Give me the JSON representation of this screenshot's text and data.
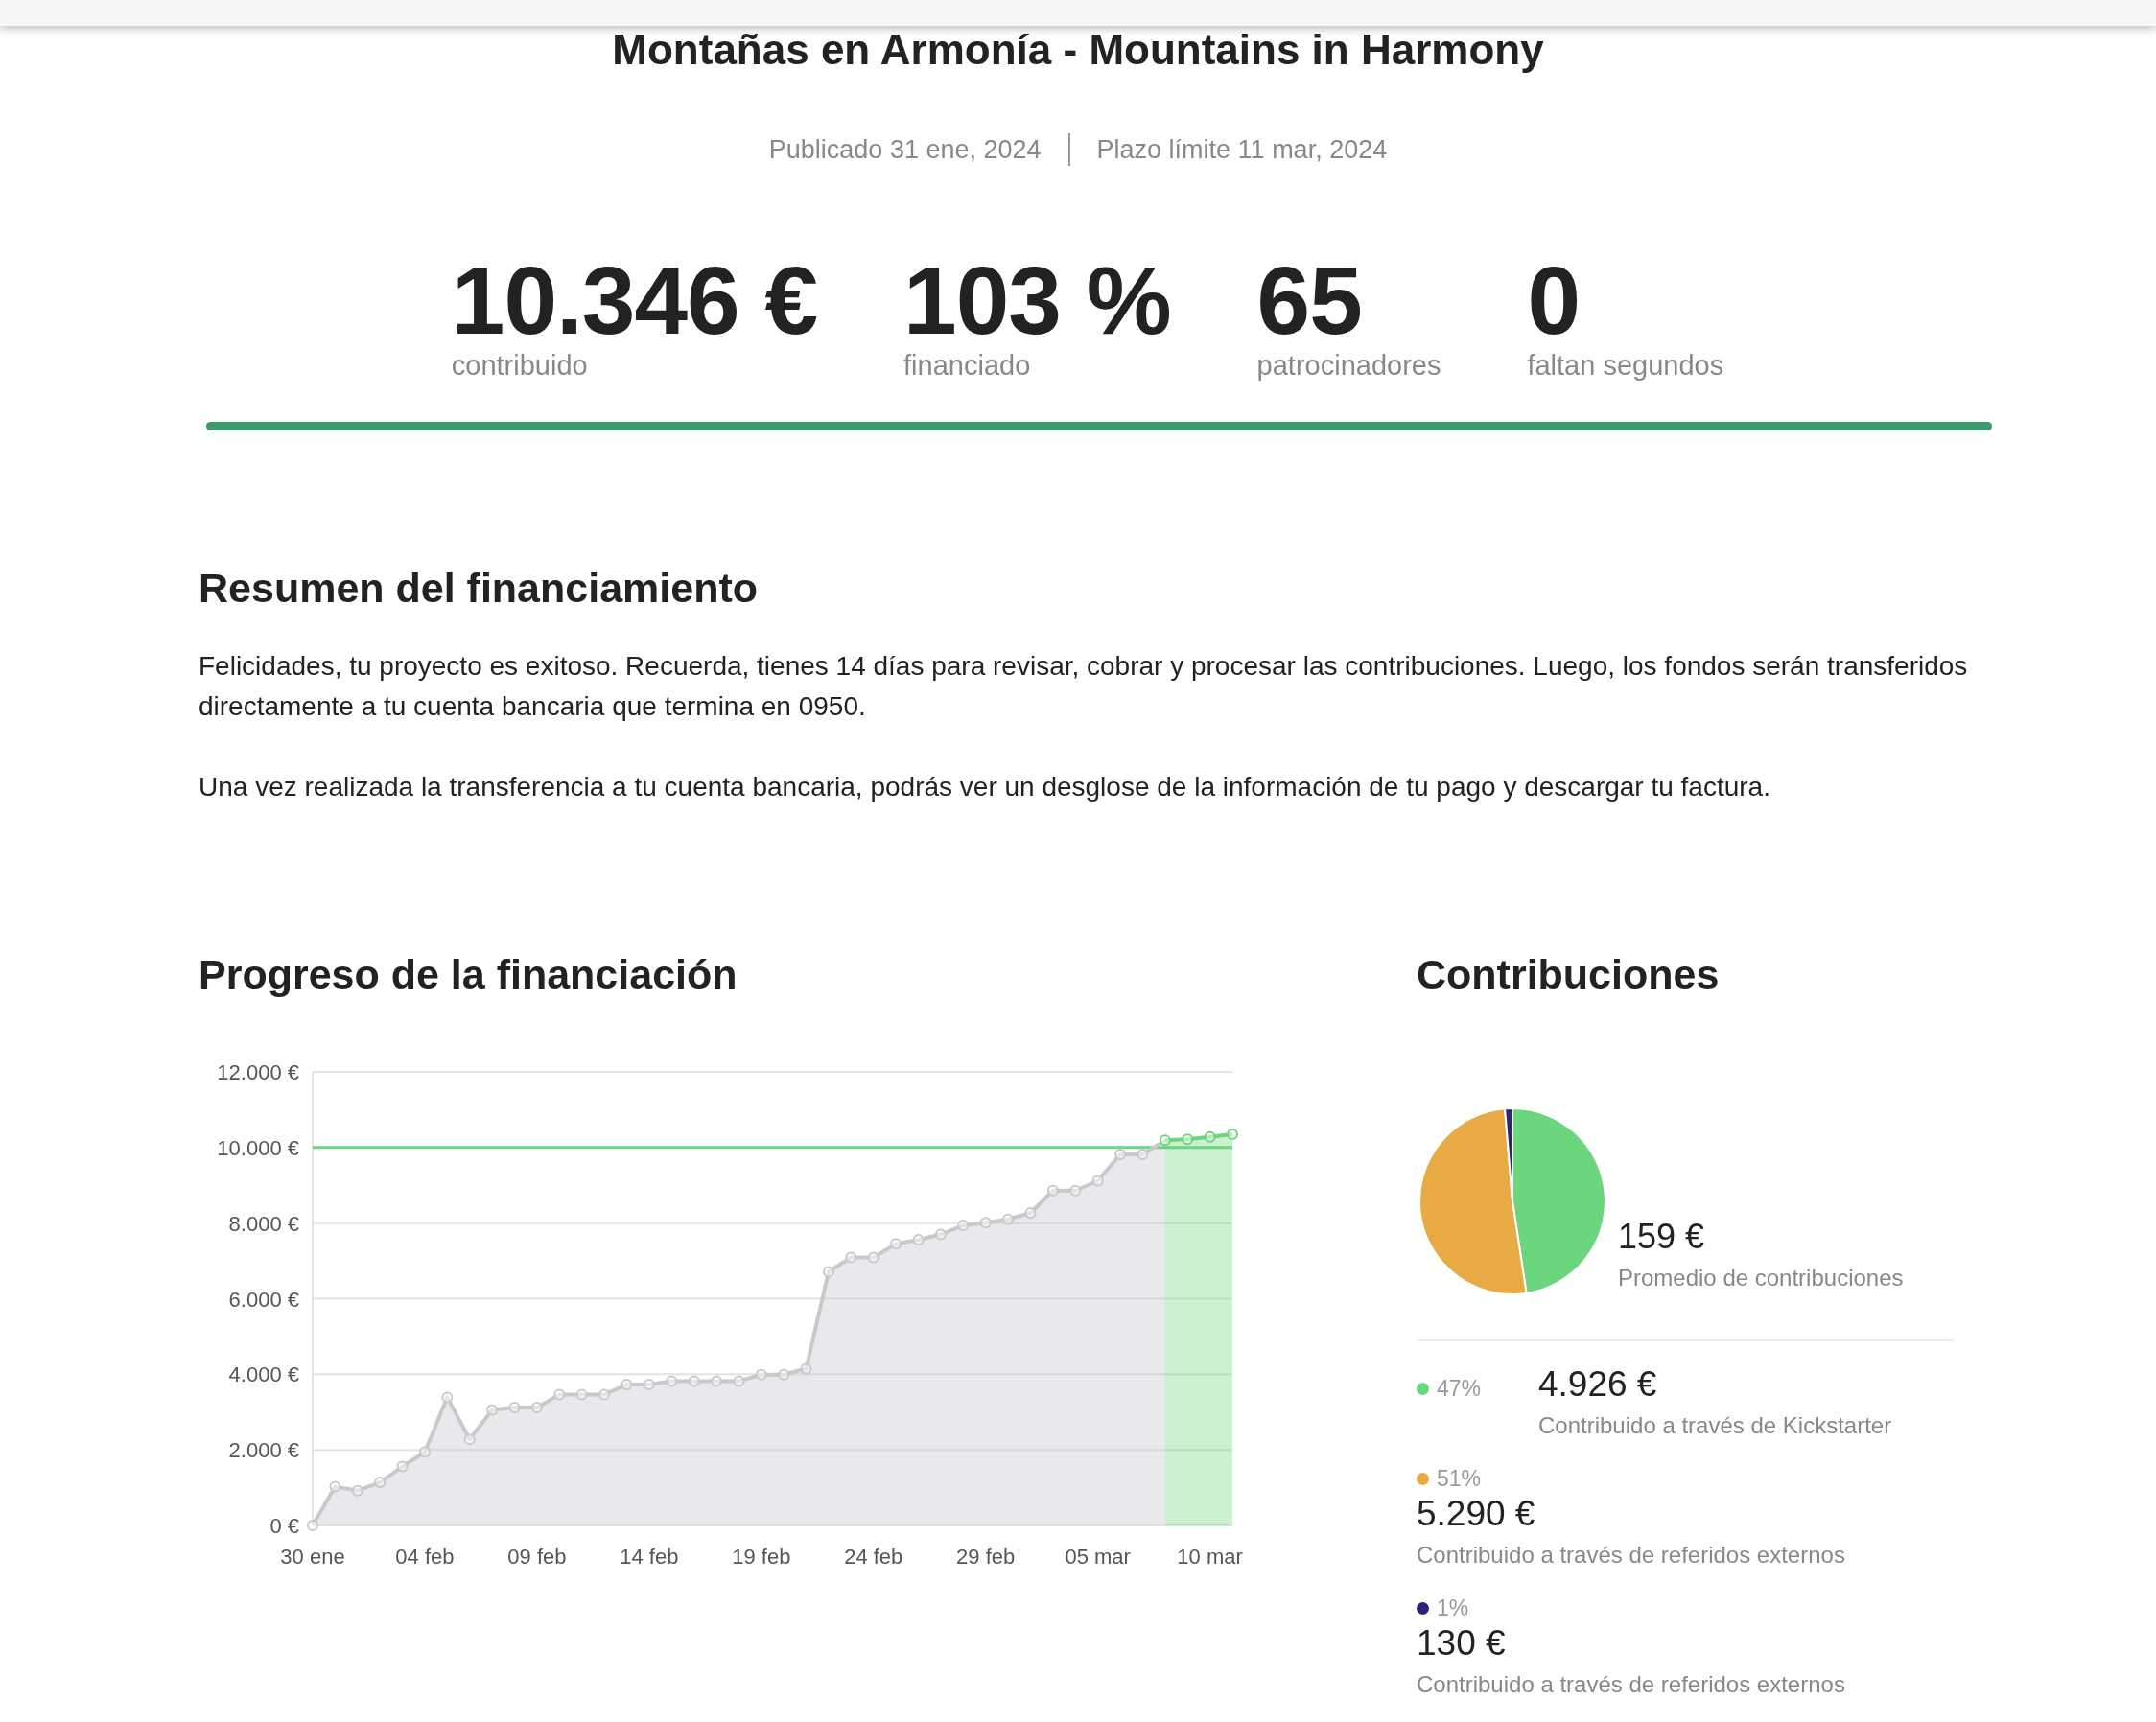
{
  "project": {
    "title": "Montañas en Armonía - Mountains in Harmony",
    "published": "Publicado 31 ene, 2024",
    "deadline": "Plazo límite 11 mar, 2024"
  },
  "stats": [
    {
      "value": "10.346 €",
      "label": "contribuido"
    },
    {
      "value": "103 %",
      "label": "financiado"
    },
    {
      "value": "65",
      "label": "patrocinadores"
    },
    {
      "value": "0",
      "label": "faltan segundos"
    }
  ],
  "funding_bar": {
    "level": 1
  },
  "summary": {
    "heading": "Resumen del financiamiento",
    "paragraphs": [
      "Felicidades, tu proyecto es exitoso. Recuerda, tienes 14 días para revisar, cobrar y procesar las contribuciones. Luego, los fondos serán transferidos directamente a tu cuenta bancaria que termina en 0950.",
      "Una vez realizada la transferencia a tu cuenta bancaria, podrás ver un desglose de la información de tu pago y descargar tu factura."
    ]
  },
  "progress": {
    "heading": "Progreso de la financiación",
    "chart_data": {
      "type": "area",
      "categories": [
        "30 ene",
        null,
        null,
        null,
        null,
        "04 feb",
        null,
        null,
        null,
        null,
        "09 feb",
        null,
        null,
        null,
        null,
        "14 feb",
        null,
        null,
        null,
        null,
        "19 feb",
        null,
        null,
        null,
        null,
        "24 feb",
        null,
        null,
        null,
        null,
        "29 feb",
        null,
        null,
        null,
        null,
        "05 mar",
        null,
        null,
        null,
        null,
        "10 mar",
        null
      ],
      "series": [
        {
          "color": "#c9c9cd",
          "values": [
            0,
            1030,
            920,
            1140,
            1560,
            1940,
            3390,
            2280,
            3060,
            3120,
            3120,
            3460,
            3460,
            3460,
            3730,
            3730,
            3820,
            3820,
            3820,
            3820,
            3990,
            3990,
            4150,
            6710,
            7090,
            7090,
            7450,
            7560,
            7700,
            7940,
            8010,
            8100,
            8270,
            8860,
            8860,
            9120,
            9820,
            9820,
            10190,
            null,
            null,
            null
          ]
        },
        {
          "color": "#6bd67e",
          "values": [
            null,
            null,
            null,
            null,
            null,
            null,
            null,
            null,
            null,
            null,
            null,
            null,
            null,
            null,
            null,
            null,
            null,
            null,
            null,
            null,
            null,
            null,
            null,
            null,
            null,
            null,
            null,
            null,
            null,
            null,
            null,
            null,
            null,
            null,
            null,
            null,
            null,
            null,
            10190,
            10220,
            10280,
            10350
          ]
        }
      ],
      "ylim": [
        0,
        12000
      ],
      "yticks": [
        {
          "value": 0,
          "label": "0 €"
        },
        {
          "value": 2000,
          "label": "2.000 €"
        },
        {
          "value": 4000,
          "label": "4.000 €"
        },
        {
          "value": 6000,
          "label": "6.000 €"
        },
        {
          "value": 8000,
          "label": "8.000 €"
        },
        {
          "value": 10000,
          "label": "10.000 €"
        },
        {
          "value": 12000,
          "label": "12.000 €"
        }
      ],
      "grid": true,
      "ref_lines": [
        {
          "axis": "y",
          "value": 10000,
          "color": "#6bd67e"
        }
      ]
    }
  },
  "contributions": {
    "heading": "Contribuciones",
    "chart_data": {
      "type": "pie",
      "values": [
        47.6,
        51.1,
        1.3
      ]
    },
    "average": {
      "value": "159 €",
      "label": "Promedio de contribuciones"
    },
    "items": [
      {
        "kind": "inline",
        "color": "#6bd67e",
        "percent": "47%",
        "amount": "4.926 €",
        "label": "Contribuido a través de Kickstarter"
      },
      {
        "kind": "stacked",
        "color": "#e8aa42",
        "percent": "51%",
        "amount": "5.290 €",
        "label": "Contribuido a través de referidos externos"
      },
      {
        "kind": "stacked",
        "color": "#2c2477",
        "percent": "1%",
        "amount": "130 €",
        "label": "Contribuido a través de referidos externos"
      }
    ]
  }
}
